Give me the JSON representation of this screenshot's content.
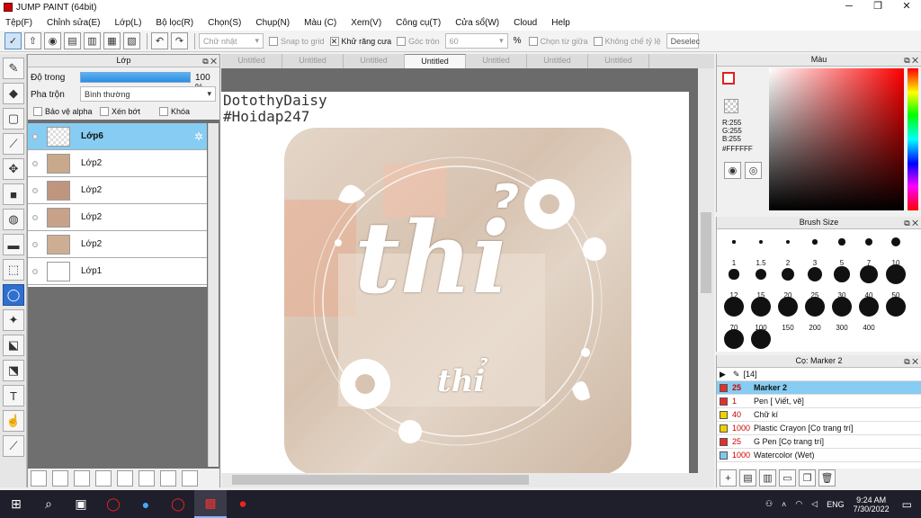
{
  "app": {
    "title": "JUMP PAINT (64bit)"
  },
  "menu": [
    "Tệp(F)",
    "Chỉnh sửa(E)",
    "Lớp(L)",
    "Bộ lọc(R)",
    "Chọn(S)",
    "Chụp(N)",
    "Màu (C)",
    "Xem(V)",
    "Công cụ(T)",
    "Cửa sổ(W)",
    "Cloud",
    "Help"
  ],
  "toolbar": {
    "shape_select": "Chữ nhật",
    "snap": "Snap to grid",
    "antialias": "Khử răng cưa",
    "round": "Góc tròn",
    "round_value": "60",
    "percent": "%",
    "from_center": "Chọn từ giữa",
    "fixed_ratio": "Không chế tỷ lệ",
    "deselect": "Deselec"
  },
  "layer_panel": {
    "title": "Lớp",
    "opacity_label": "Độ trong",
    "opacity_value": "100 %",
    "blend_label": "Pha trộn",
    "blend_value": "Bình thường",
    "protect_alpha": "Bảo vệ alpha",
    "clip": "Xén bớt",
    "lock": "Khóa",
    "layers": [
      {
        "name": "Lớp6",
        "selected": true
      },
      {
        "name": "Lớp2"
      },
      {
        "name": "Lớp2"
      },
      {
        "name": "Lớp2"
      },
      {
        "name": "Lớp2"
      },
      {
        "name": "Lớp1"
      }
    ]
  },
  "tabs": [
    "Untitled",
    "Untitled",
    "Untitled",
    "Untitled",
    "Untitled",
    "Untitled",
    "Untitled"
  ],
  "canvas": {
    "watermark1": "DotothyDaisy",
    "watermark2": "#Hoidap247",
    "art_main": "thỉ",
    "art_sub": "thỉ"
  },
  "color_panel": {
    "title": "Màu",
    "r": "R:255",
    "g": "G:255",
    "b": "B:255",
    "hex": "#FFFFFF"
  },
  "brush_panel": {
    "title": "Brush Size",
    "sizes": [
      "1",
      "1.5",
      "2",
      "3",
      "5",
      "7",
      "10",
      "12",
      "15",
      "20",
      "25",
      "30",
      "40",
      "50",
      "70",
      "100",
      "150",
      "200",
      "300",
      "400",
      "",
      "",
      ""
    ]
  },
  "marker_panel": {
    "title": "Cọ: Marker 2",
    "group": "[14]",
    "items": [
      {
        "size": "25",
        "name": "Marker 2",
        "color": "#e03030",
        "selected": true
      },
      {
        "size": "1",
        "name": "Pen [ Viết, vẽ]",
        "color": "#e03030"
      },
      {
        "size": "40",
        "name": "Chữ kí",
        "color": "#f0d000"
      },
      {
        "size": "1000",
        "name": "Plastic Crayon [Cọ trang trí]",
        "color": "#f0d000"
      },
      {
        "size": "25",
        "name": "G Pen [Cọ trang trí]",
        "color": "#e03030"
      },
      {
        "size": "1000",
        "name": "Watercolor (Wet)",
        "color": "#80c8f0"
      }
    ]
  },
  "taskbar": {
    "time": "9:24 AM",
    "date": "7/30/2022",
    "lang": "ENG"
  }
}
